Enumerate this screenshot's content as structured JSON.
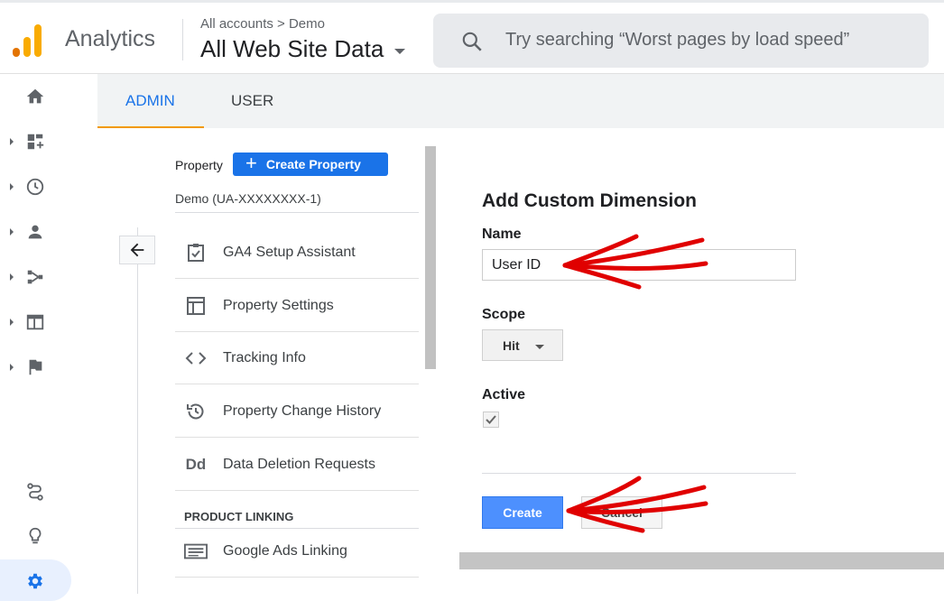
{
  "header": {
    "app_name": "Analytics",
    "breadcrumb": "All accounts > Demo",
    "view_title": "All Web Site Data",
    "search_placeholder": "Try searching “Worst pages by load speed”",
    "logo_colors": [
      "#f9ab00",
      "#e37400"
    ]
  },
  "leftnav": {
    "items": [
      {
        "icon": "home-icon"
      },
      {
        "icon": "dashboard-icon"
      },
      {
        "icon": "clock-icon"
      },
      {
        "icon": "person-icon"
      },
      {
        "icon": "acquisition-icon"
      },
      {
        "icon": "behavior-icon"
      },
      {
        "icon": "flag-icon"
      }
    ],
    "bottom": [
      {
        "icon": "path-icon"
      },
      {
        "icon": "lightbulb-icon"
      },
      {
        "icon": "gear-icon"
      }
    ]
  },
  "tabs": [
    {
      "label": "ADMIN",
      "active": true
    },
    {
      "label": "USER",
      "active": false
    }
  ],
  "property": {
    "label": "Property",
    "create_button": "Create Property",
    "name": "Demo (UA-XXXXXXXX-1)"
  },
  "menu": {
    "items": [
      {
        "label": "GA4 Setup Assistant",
        "icon": "clipboard-check-icon"
      },
      {
        "label": "Property Settings",
        "icon": "layout-icon"
      },
      {
        "label": "Tracking Info",
        "icon": "code-icon"
      },
      {
        "label": "Property Change History",
        "icon": "history-icon"
      },
      {
        "label": "Data Deletion Requests",
        "icon": "dd-icon"
      }
    ],
    "section_heading": "PRODUCT LINKING",
    "linking_items": [
      {
        "label": "Google Ads Linking",
        "icon": "ads-icon"
      }
    ]
  },
  "form": {
    "title": "Add Custom Dimension",
    "name_label": "Name",
    "name_value": "User ID",
    "scope_label": "Scope",
    "scope_value": "Hit",
    "active_label": "Active",
    "active_checked": true,
    "create_label": "Create",
    "cancel_label": "Cancel"
  },
  "colors": {
    "accent": "#1a73e8",
    "tab_underline": "#f29900",
    "annotation": "#e00000"
  }
}
